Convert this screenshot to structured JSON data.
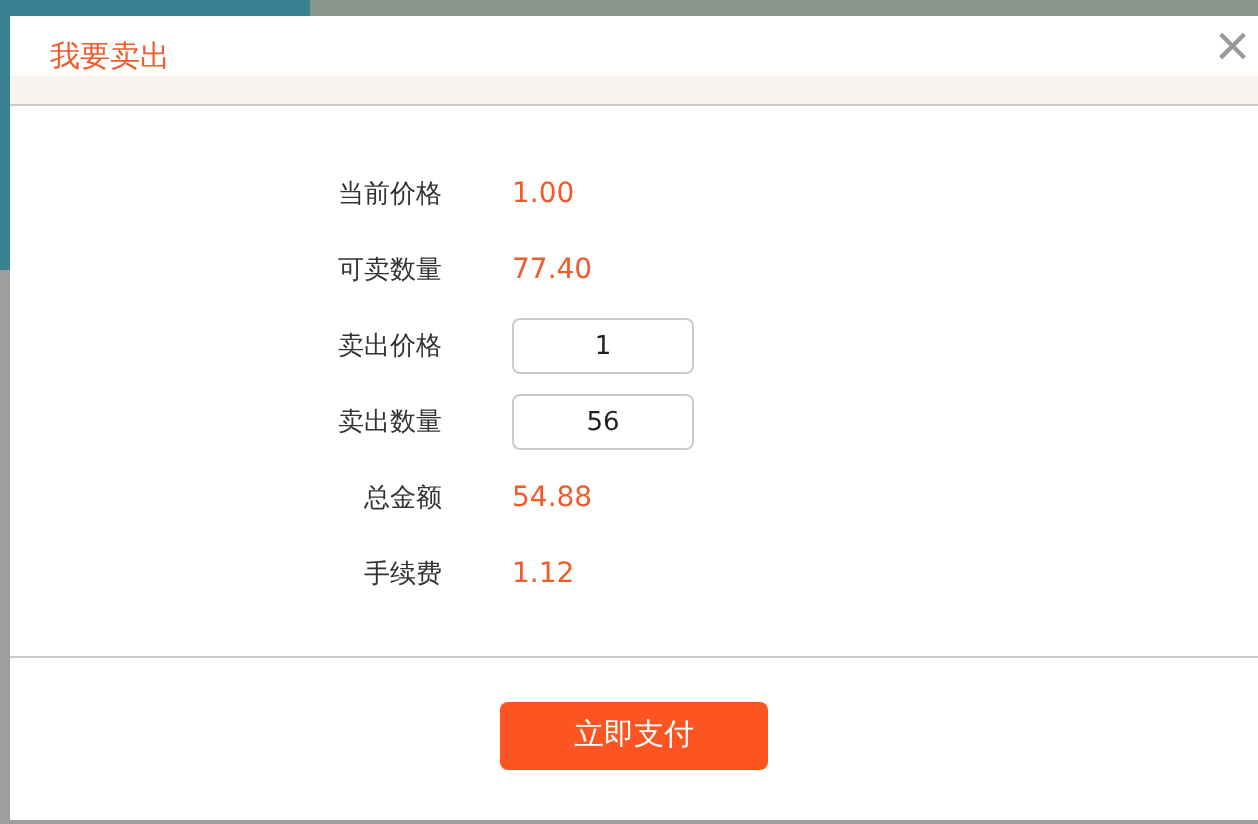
{
  "dialog": {
    "title": "我要卖出",
    "close": "×"
  },
  "fields": [
    {
      "kind": "text",
      "label": "当前价格",
      "value": "1.00"
    },
    {
      "kind": "text",
      "label": "可卖数量",
      "value": "77.40"
    },
    {
      "kind": "input",
      "label": "卖出价格",
      "value": "1"
    },
    {
      "kind": "input",
      "label": "卖出数量",
      "value": "56"
    },
    {
      "kind": "text",
      "label": "总金额",
      "value": "54.88"
    },
    {
      "kind": "text",
      "label": "手续费",
      "value": "1.12"
    }
  ],
  "submit": "立即支付"
}
